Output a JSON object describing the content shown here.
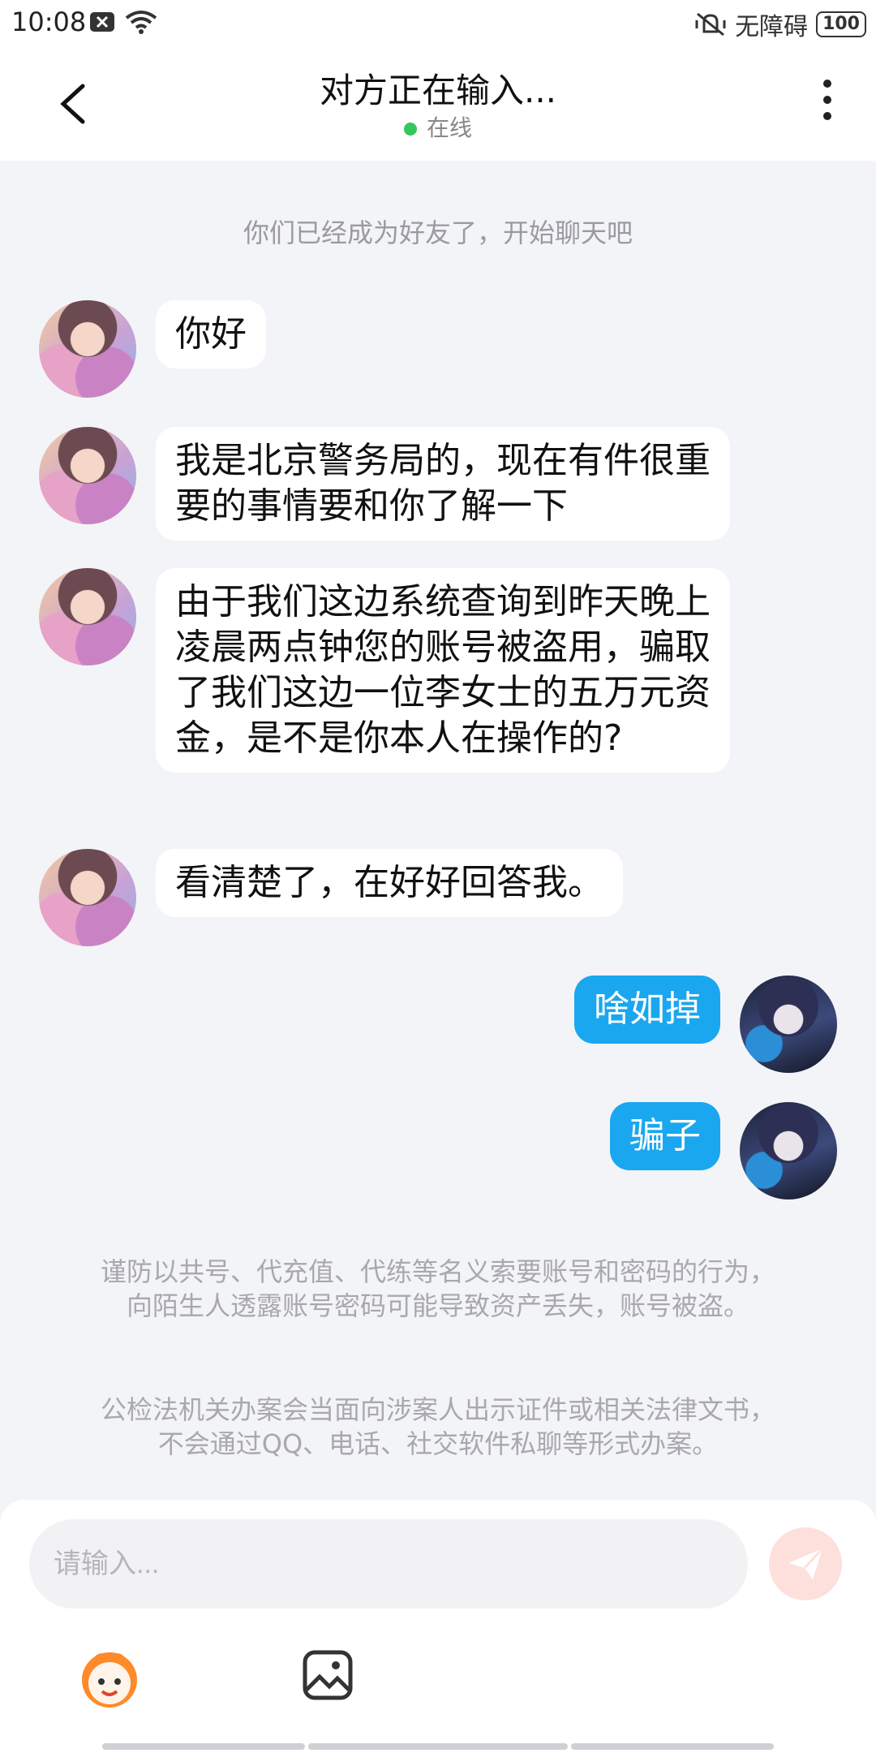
{
  "status_bar": {
    "time": "10:08",
    "accessibility": "无障碍",
    "battery": "100"
  },
  "header": {
    "title": "对方正在输入...",
    "online_status": "在线"
  },
  "system_tip": "你们已经成为好友了，开始聊天吧",
  "messages": [
    {
      "side": "left",
      "text": "你好"
    },
    {
      "side": "left",
      "text": "我是北京警务局的，现在有件很重要的事情要和你了解一下"
    },
    {
      "side": "left",
      "text": "由于我们这边系统查询到昨天晚上凌晨两点钟您的账号被盗用，骗取了我们这边一位李女士的五万元资金，是不是你本人在操作的?"
    },
    {
      "side": "left",
      "text": "看清楚了，在好好回答我。"
    },
    {
      "side": "right",
      "text": "啥如掉"
    },
    {
      "side": "right",
      "text": "骗子"
    }
  ],
  "warnings": [
    "谨防以共号、代充值、代练等名义索要账号和密码的行为，向陌生人透露账号密码可能导致资产丢失，账号被盗。",
    "公检法机关办案会当面向涉案人出示证件或相关法律文书，不会通过QQ、电话、社交软件私聊等形式办案。"
  ],
  "input": {
    "placeholder": "请输入..."
  },
  "colors": {
    "accent": "#1aa7f0",
    "online": "#34c759",
    "background": "#f3f4f7",
    "send_button": "#fde0dc"
  },
  "icons": [
    "back-arrow-icon",
    "more-vertical-icon",
    "send-icon",
    "emoji-icon",
    "image-icon",
    "wifi-icon",
    "mute-icon"
  ]
}
